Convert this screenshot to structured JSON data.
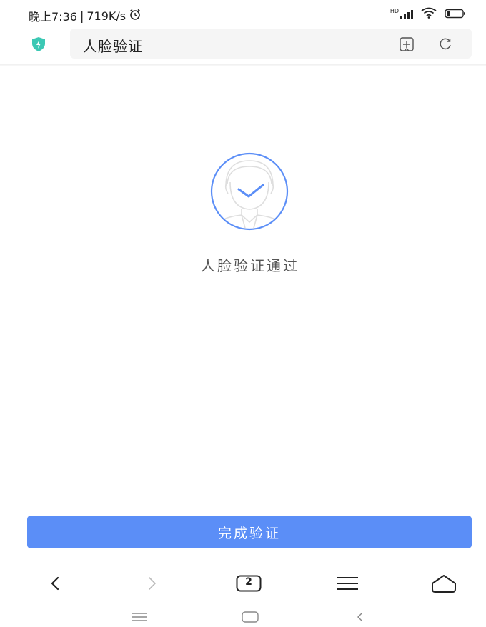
{
  "status_bar": {
    "time": "晚上7:36",
    "separator": "|",
    "net_speed": "719K/s",
    "signal_label": "HD"
  },
  "browser": {
    "page_title": "人脸验证",
    "tab_count": "2"
  },
  "content": {
    "result_text": "人脸验证通过",
    "complete_button_label": "完成验证"
  },
  "colors": {
    "accent": "#5b8ef7",
    "shield": "#3cc8b4"
  },
  "icons": {
    "status": [
      "alarm-icon",
      "signal-icon",
      "wifi-icon",
      "battery-icon"
    ],
    "address": [
      "shield-icon",
      "add-bookmark-icon",
      "refresh-icon"
    ],
    "content": [
      "face-verified-icon",
      "checkmark-icon"
    ],
    "toolbar": [
      "back-arrow-icon",
      "forward-arrow-icon",
      "tabs-icon",
      "menu-icon",
      "home-icon"
    ],
    "system": [
      "recents-icon",
      "home-nav-icon",
      "back-nav-icon"
    ]
  }
}
